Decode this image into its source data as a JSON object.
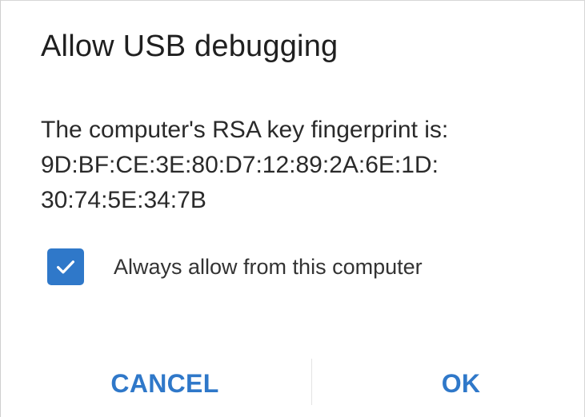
{
  "dialog": {
    "title": "Allow USB debugging",
    "message": {
      "line1": "The computer's RSA key fingerprint is:",
      "line2": "9D:BF:CE:3E:80:D7:12:89:2A:6E:1D:",
      "line3": "30:74:5E:34:7B"
    },
    "checkbox": {
      "label": "Always allow from this computer",
      "checked": true,
      "icon": "checkmark-icon"
    },
    "buttons": {
      "cancel_label": "CANCEL",
      "ok_label": "OK"
    },
    "colors": {
      "accent": "#2f78c9",
      "text": "#222222",
      "background": "#ffffff"
    }
  }
}
